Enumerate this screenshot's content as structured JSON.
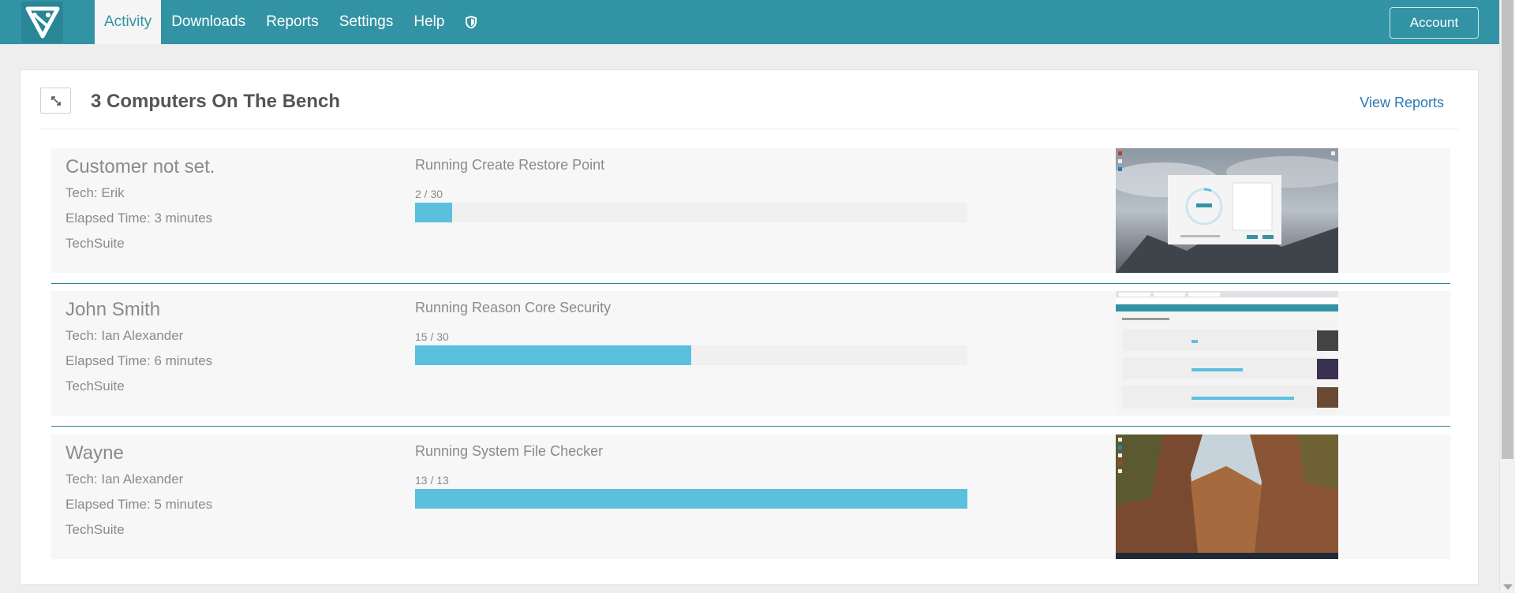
{
  "nav": {
    "items": [
      "Activity",
      "Downloads",
      "Reports",
      "Settings",
      "Help"
    ],
    "active": "Activity",
    "account_label": "Account",
    "brand_color": "#3293a4"
  },
  "panel": {
    "title": "3 Computers On The Bench",
    "view_reports": "View Reports"
  },
  "computers": [
    {
      "customer": "Customer not set.",
      "tech": "Tech: Erik",
      "elapsed": "Elapsed Time: 3 minutes",
      "suite": "TechSuite",
      "task": "Running Create Restore Point",
      "progress_text": "2 / 30",
      "progress": 0.0667,
      "thumbnail": "dialog-over-mountain-clouds"
    },
    {
      "customer": "John Smith",
      "tech": "Tech: Ian Alexander",
      "elapsed": "Elapsed Time: 6 minutes",
      "suite": "TechSuite",
      "task": "Running Reason Core Security",
      "progress_text": "15 / 30",
      "progress": 0.5,
      "thumbnail": "browser-dashboard-screenshot"
    },
    {
      "customer": "Wayne",
      "tech": "Tech: Ian Alexander",
      "elapsed": "Elapsed Time: 5 minutes",
      "suite": "TechSuite",
      "task": "Running System File Checker",
      "progress_text": "13 / 13",
      "progress": 1.0,
      "thumbnail": "canyon-desktop"
    }
  ]
}
